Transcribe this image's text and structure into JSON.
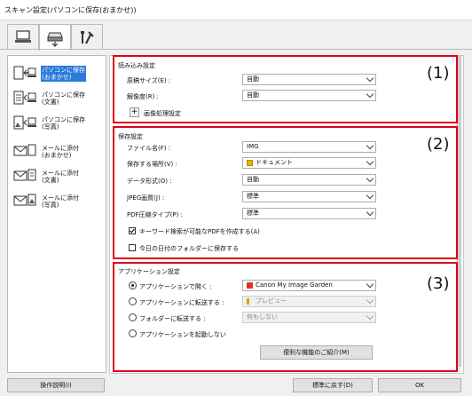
{
  "window": {
    "title": "スキャン設定(パソコンに保存(おまかせ))"
  },
  "tabs": [
    {
      "icon": "scan-from-computer-icon",
      "active": false
    },
    {
      "icon": "scan-from-panel-icon",
      "active": true
    },
    {
      "icon": "general-settings-icon",
      "active": false
    }
  ],
  "sidebar": {
    "items": [
      {
        "label": "パソコンに保存\n(おまかせ)",
        "icon": "save-to-pc-icon",
        "selected": true
      },
      {
        "label": "パソコンに保存\n(文書)",
        "icon": "save-to-pc-icon",
        "selected": false
      },
      {
        "label": "パソコンに保存\n(写真)",
        "icon": "save-to-pc-icon",
        "selected": false
      },
      {
        "label": "メールに添付\n(おまかせ)",
        "icon": "mail-attach-icon",
        "selected": false
      },
      {
        "label": "メールに添付\n(文書)",
        "icon": "mail-attach-icon",
        "selected": false
      },
      {
        "label": "メールに添付\n(写真)",
        "icon": "mail-attach-icon",
        "selected": false
      }
    ]
  },
  "scan_options": {
    "title": "読み込み設定",
    "number": "(1)",
    "paper_size_label": "原稿サイズ(E) :",
    "paper_size_value": "自動",
    "resolution_label": "解像度(R) :",
    "resolution_value": "自動",
    "image_processing_label": "画像処理設定",
    "plus": "+"
  },
  "save_settings": {
    "title": "保存設定",
    "number": "(2)",
    "file_name_label": "ファイル名(F) :",
    "file_name_value": "IMG",
    "save_in_label": "保存する場所(V) :",
    "save_in_value": "ドキュメント",
    "data_format_label": "データ形式(O) :",
    "data_format_value": "自動",
    "jpeg_quality_label": "JPEG画質(J) :",
    "jpeg_quality_value": "標準",
    "pdf_compression_label": "PDF圧縮タイプ(P) :",
    "pdf_compression_value": "標準",
    "keyword_pdf_label": "キーワード検索が可能なPDFを作成する(A)",
    "keyword_pdf_checked": true,
    "date_folder_label": "今日の日付のフォルダーに保存する",
    "date_folder_checked": false
  },
  "app_settings": {
    "title": "アプリケーション設定",
    "number": "(3)",
    "open_with_label": "アプリケーションで開く :",
    "open_with_value": "Canon My Image Garden",
    "send_to_app_label": "アプリケーションに転送する :",
    "send_to_app_value": "プレビュー",
    "send_to_folder_label": "フォルダーに転送する :",
    "send_to_folder_value": "何もしない",
    "do_not_start_label": "アプリケーションを起動しない",
    "more_functions_label": "便利な機能のご紹介(M)",
    "selected_option": "open_with"
  },
  "footer": {
    "instructions_label": "操作説明(I)",
    "defaults_label": "標準に戻す(D)",
    "ok_label": "OK"
  },
  "colors": {
    "highlight": "#e0001a",
    "selection": "#2a7ad9"
  }
}
